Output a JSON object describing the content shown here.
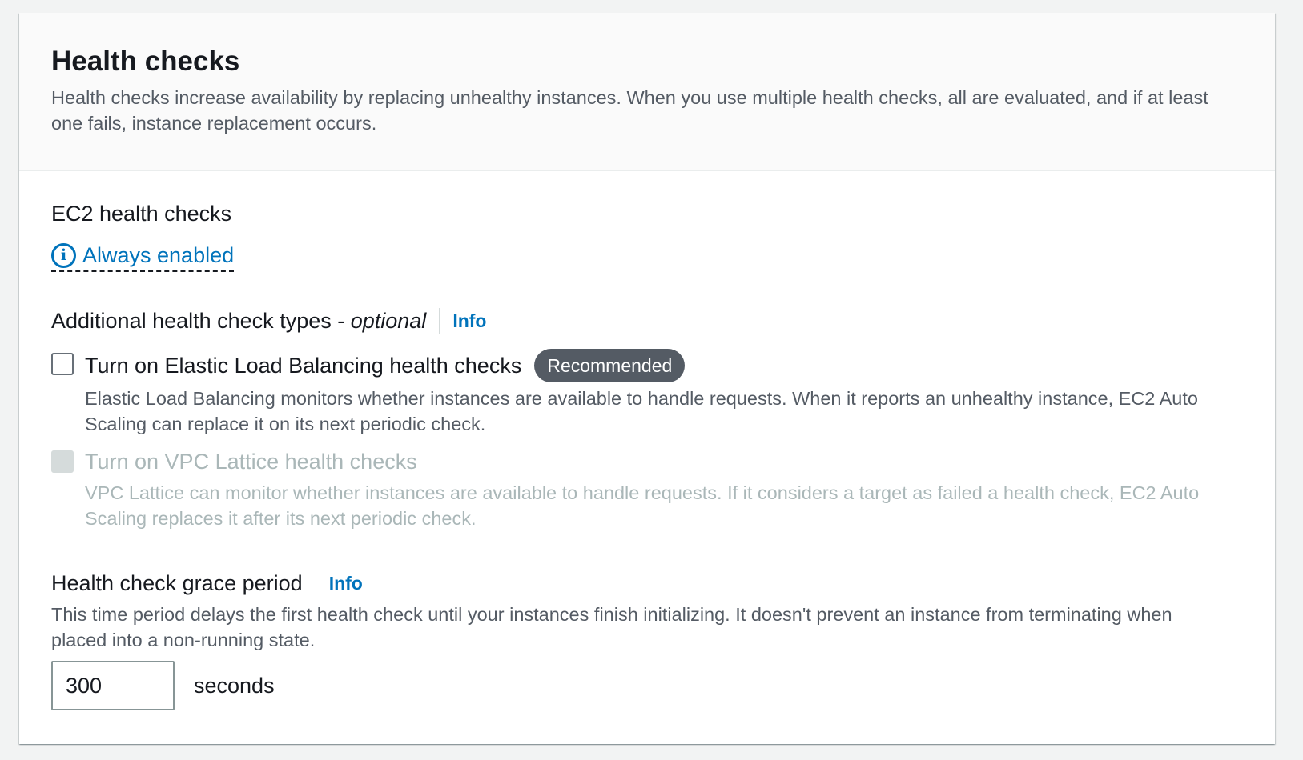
{
  "header": {
    "title": "Health checks",
    "description": "Health checks increase availability by replacing unhealthy instances. When you use multiple health checks, all are evaluated, and if at least one fails, instance replacement occurs."
  },
  "ec2": {
    "label": "EC2 health checks",
    "status": "Always enabled",
    "status_icon": "info-circle-icon"
  },
  "additional": {
    "label": "Additional health check types - ",
    "optional": "optional",
    "info": "Info",
    "options": [
      {
        "label": "Turn on Elastic Load Balancing health checks",
        "badge": "Recommended",
        "description": "Elastic Load Balancing monitors whether instances are available to handle requests. When it reports an unhealthy instance, EC2 Auto Scaling can replace it on its next periodic check.",
        "checked": false,
        "disabled": false
      },
      {
        "label": "Turn on VPC Lattice health checks",
        "description": "VPC Lattice can monitor whether instances are available to handle requests. If it considers a target as failed a health check, EC2 Auto Scaling replaces it after its next periodic check.",
        "checked": false,
        "disabled": true
      }
    ]
  },
  "grace": {
    "label": "Health check grace period",
    "info": "Info",
    "description": "This time period delays the first health check until your instances finish initializing. It doesn't prevent an instance from terminating when placed into a non-running state.",
    "value": "300",
    "unit": "seconds"
  },
  "colors": {
    "link": "#0073bb",
    "badge": "#545b64",
    "disabled": "#aab7b8"
  }
}
